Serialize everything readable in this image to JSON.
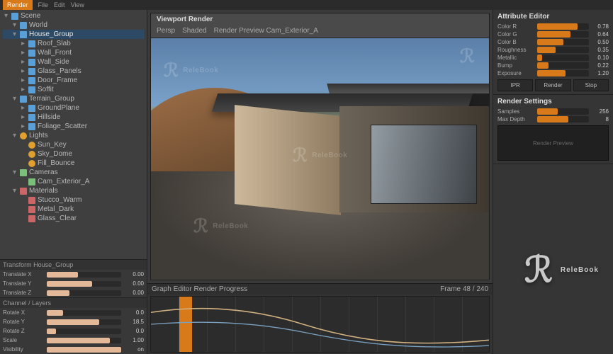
{
  "watermark": "ReleBook",
  "menu": {
    "items": [
      "File",
      "Edit",
      "Render",
      "View"
    ],
    "active": "Render"
  },
  "outliner": {
    "items": [
      {
        "indent": 0,
        "tw": "▾",
        "ico": "box",
        "label": "Scene",
        "sel": false
      },
      {
        "indent": 1,
        "tw": "▾",
        "ico": "box",
        "label": "World",
        "sel": false
      },
      {
        "indent": 1,
        "tw": "▾",
        "ico": "box",
        "label": "House_Group",
        "sel": true
      },
      {
        "indent": 2,
        "tw": "▸",
        "ico": "box",
        "label": "Roof_Slab",
        "sel": false
      },
      {
        "indent": 2,
        "tw": "▸",
        "ico": "box",
        "label": "Wall_Front",
        "sel": false
      },
      {
        "indent": 2,
        "tw": "▸",
        "ico": "box",
        "label": "Wall_Side",
        "sel": false
      },
      {
        "indent": 2,
        "tw": "▸",
        "ico": "box",
        "label": "Glass_Panels",
        "sel": false
      },
      {
        "indent": 2,
        "tw": "▸",
        "ico": "box",
        "label": "Door_Frame",
        "sel": false
      },
      {
        "indent": 2,
        "tw": "▸",
        "ico": "box",
        "label": "Soffit",
        "sel": false
      },
      {
        "indent": 1,
        "tw": "▾",
        "ico": "box",
        "label": "Terrain_Group",
        "sel": false
      },
      {
        "indent": 2,
        "tw": "▸",
        "ico": "box",
        "label": "GroundPlane",
        "sel": false
      },
      {
        "indent": 2,
        "tw": "▸",
        "ico": "box",
        "label": "Hillside",
        "sel": false
      },
      {
        "indent": 2,
        "tw": "▸",
        "ico": "box",
        "label": "Foliage_Scatter",
        "sel": false
      },
      {
        "indent": 1,
        "tw": "▾",
        "ico": "lt",
        "label": "Lights",
        "sel": false
      },
      {
        "indent": 2,
        "tw": " ",
        "ico": "lt",
        "label": "Sun_Key",
        "sel": false
      },
      {
        "indent": 2,
        "tw": " ",
        "ico": "lt",
        "label": "Sky_Dome",
        "sel": false
      },
      {
        "indent": 2,
        "tw": " ",
        "ico": "lt",
        "label": "Fill_Bounce",
        "sel": false
      },
      {
        "indent": 1,
        "tw": "▾",
        "ico": "cam",
        "label": "Cameras",
        "sel": false
      },
      {
        "indent": 2,
        "tw": " ",
        "ico": "cam",
        "label": "Cam_Exterior_A",
        "sel": false
      },
      {
        "indent": 1,
        "tw": "▾",
        "ico": "mat",
        "label": "Materials",
        "sel": false
      },
      {
        "indent": 2,
        "tw": " ",
        "ico": "mat",
        "label": "Stucco_Warm",
        "sel": false
      },
      {
        "indent": 2,
        "tw": " ",
        "ico": "mat",
        "label": "Metal_Dark",
        "sel": false
      },
      {
        "indent": 2,
        "tw": " ",
        "ico": "mat",
        "label": "Glass_Clear",
        "sel": false
      }
    ]
  },
  "channelBox": {
    "title": "Transform   House_Group",
    "rows": [
      {
        "label": "Translate X",
        "pct": 42,
        "val": "0.00"
      },
      {
        "label": "Translate Y",
        "pct": 61,
        "val": "0.00"
      },
      {
        "label": "Translate Z",
        "pct": 30,
        "val": "0.00"
      }
    ]
  },
  "channelBox2": {
    "title": "Channel / Layers",
    "rows": [
      {
        "label": "Rotate X",
        "pct": 22,
        "val": "0.0"
      },
      {
        "label": "Rotate Y",
        "pct": 70,
        "val": "18.5"
      },
      {
        "label": "Rotate Z",
        "pct": 12,
        "val": "0.0"
      },
      {
        "label": "Scale",
        "pct": 85,
        "val": "1.00"
      },
      {
        "label": "Visibility",
        "pct": 100,
        "val": "on"
      }
    ]
  },
  "viewport": {
    "title": "Viewport Render",
    "subtabs": [
      "Persp",
      "Shaded",
      "Render Preview   Cam_Exterior_A"
    ]
  },
  "timeline": {
    "title": "Graph Editor   Render Progress",
    "frame": "Frame 48 / 240"
  },
  "attr": {
    "title": "Attribute Editor",
    "rows": [
      {
        "label": "Color R",
        "pct": 78,
        "val": "0.78"
      },
      {
        "label": "Color G",
        "pct": 64,
        "val": "0.64"
      },
      {
        "label": "Color B",
        "pct": 50,
        "val": "0.50"
      },
      {
        "label": "Roughness",
        "pct": 35,
        "val": "0.35"
      },
      {
        "label": "Metallic",
        "pct": 10,
        "val": "0.10"
      },
      {
        "label": "Bump",
        "pct": 22,
        "val": "0.22"
      },
      {
        "label": "Exposure",
        "pct": 55,
        "val": "1.20"
      }
    ]
  },
  "renderBtns": {
    "a": "IPR",
    "b": "Render",
    "c": "Stop"
  },
  "renderSettings": {
    "title": "Render Settings",
    "rows": [
      {
        "label": "Samples",
        "pct": 40,
        "val": "256"
      },
      {
        "label": "Max Depth",
        "pct": 60,
        "val": "8"
      }
    ],
    "previewLabel": "Render Preview"
  }
}
